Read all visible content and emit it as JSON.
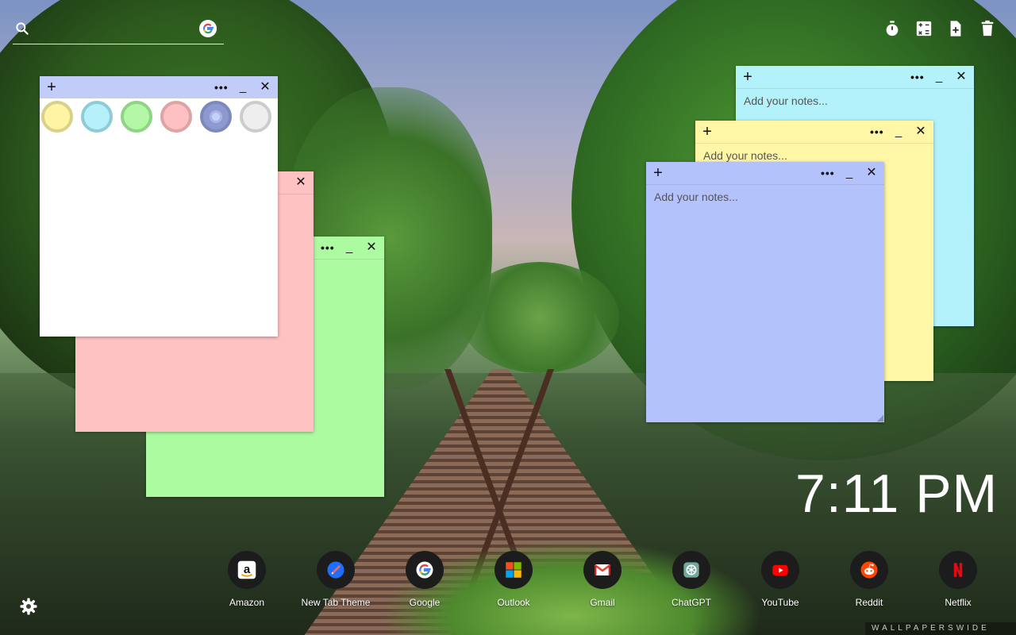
{
  "search": {
    "placeholder": "",
    "engine_icon": "google-g-icon"
  },
  "toolbar": {
    "buttons": [
      {
        "name": "timer",
        "icon": "stopwatch-icon"
      },
      {
        "name": "calculator",
        "icon": "calculator-icon"
      },
      {
        "name": "add-note",
        "icon": "file-add-icon"
      },
      {
        "name": "delete",
        "icon": "trash-icon"
      }
    ]
  },
  "notes": [
    {
      "id": "cyan",
      "color": "#b3f1fb",
      "plus": "+",
      "dots": "•••",
      "minimize": "_",
      "close": "✕",
      "placeholder": "Add your notes..."
    },
    {
      "id": "yellow",
      "color": "#fff6a6",
      "plus": "+",
      "dots": "•••",
      "minimize": "_",
      "close": "✕",
      "placeholder": "Add your notes..."
    },
    {
      "id": "blue",
      "color": "#b4c2fb",
      "plus": "+",
      "dots": "•••",
      "minimize": "_",
      "close": "✕",
      "placeholder": "Add your notes..."
    },
    {
      "id": "green",
      "color": "#adfba0",
      "dots": "•••",
      "minimize": "_",
      "close": "✕"
    },
    {
      "id": "pink",
      "color": "#fec2c3",
      "close": "✕"
    },
    {
      "id": "white",
      "color": "#ffffff",
      "header_color": "#c1ccf9",
      "plus": "+",
      "dots": "•••",
      "minimize": "_",
      "close": "✕"
    }
  ],
  "palette": {
    "swatches": [
      {
        "name": "yellow",
        "fill": "#fff4a3",
        "ring": "#d9d08a"
      },
      {
        "name": "cyan",
        "fill": "#b6f1fb",
        "ring": "#8fcbd6"
      },
      {
        "name": "green",
        "fill": "#b3f8a6",
        "ring": "#8fd384"
      },
      {
        "name": "pink",
        "fill": "#fdc1c3",
        "ring": "#dea3a5"
      },
      {
        "name": "blue",
        "fill": "#a9b4e4",
        "ring": "#8590bf",
        "selected": true
      },
      {
        "name": "gray",
        "fill": "#eeeeee",
        "ring": "#cccccc"
      }
    ]
  },
  "clock": {
    "time": "7:11 PM"
  },
  "dock": {
    "apps": [
      {
        "label": "Amazon",
        "icon": "amazon-icon"
      },
      {
        "label": "New Tab Theme",
        "icon": "new-tab-theme-icon"
      },
      {
        "label": "Google",
        "icon": "google-icon"
      },
      {
        "label": "Outlook",
        "icon": "outlook-icon"
      },
      {
        "label": "Gmail",
        "icon": "gmail-icon"
      },
      {
        "label": "ChatGPT",
        "icon": "chatgpt-icon"
      },
      {
        "label": "YouTube",
        "icon": "youtube-icon"
      },
      {
        "label": "Reddit",
        "icon": "reddit-icon"
      },
      {
        "label": "Netflix",
        "icon": "netflix-icon"
      }
    ]
  },
  "settings": {
    "icon": "gear-icon"
  },
  "watermark": {
    "text": "WALLPAPERSWIDE"
  }
}
